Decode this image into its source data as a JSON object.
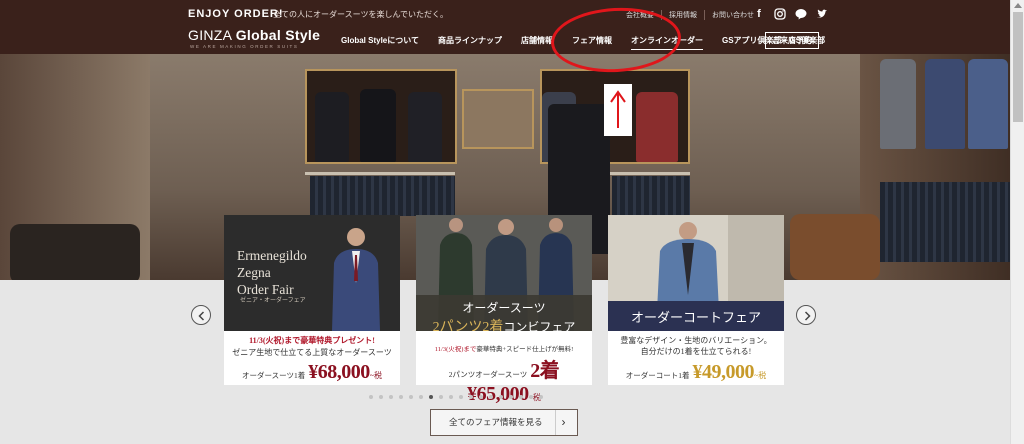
{
  "header": {
    "enjoy": "ENJOY ORDER!",
    "tagline": "全ての人にオーダースーツを楽しんでいただく。",
    "logo_plain": "GINZA ",
    "logo_bold": "Global Style",
    "logo_sub": "WE ARE MAKING ORDER SUITS",
    "toplinks": [
      "会社概要",
      "採用情報",
      "お問い合わせ"
    ],
    "social": [
      "facebook-icon",
      "instagram-icon",
      "line-icon",
      "twitter-icon"
    ],
    "nav": [
      "Global Styleについて",
      "商品ラインナップ",
      "店舗情報",
      "フェア情報",
      "オンラインオーダー",
      "GSアプリ倶楽部・GS倶楽部"
    ],
    "nav_active_index": 4,
    "reserve": "ご来店予約"
  },
  "cards": [
    {
      "title_lines": [
        "Ermenegildo",
        "Zegna",
        "Order Fair"
      ],
      "subtitle": "ゼニア・オーダーフェア",
      "line1": "11/3(火祝)まで豪華特典プレゼント!",
      "line2": "ゼニア生地で仕立てる上質なオーダースーツ",
      "price_label": "オーダースーツ1着",
      "price": "¥68,000",
      "price_suffix": "~税"
    },
    {
      "title1": "オーダースーツ",
      "title2_gold": "2パンツ2着",
      "title2_rest": "コンビフェア",
      "line2_red": "11/3(火祝)まで",
      "line2_rest": "豪華特典+スピード仕上げが無料!",
      "price_label": "2パンツオーダースーツ",
      "price": "2着¥65,000",
      "price_suffix": "~税"
    },
    {
      "title": "オーダーコートフェア",
      "line1": "豊富なデザイン・生地のバリエーション。",
      "line2": "自分だけの1着を仕立てられる!",
      "price_label": "オーダーコート1着",
      "price": "¥49,000",
      "price_suffix": "~税"
    }
  ],
  "carousel": {
    "dot_count": 18,
    "active_dot": 6
  },
  "fair_button": "全てのフェア情報を見る",
  "colors": {
    "header_bg": "#3a211b",
    "annotation_red": "#e0161b"
  }
}
